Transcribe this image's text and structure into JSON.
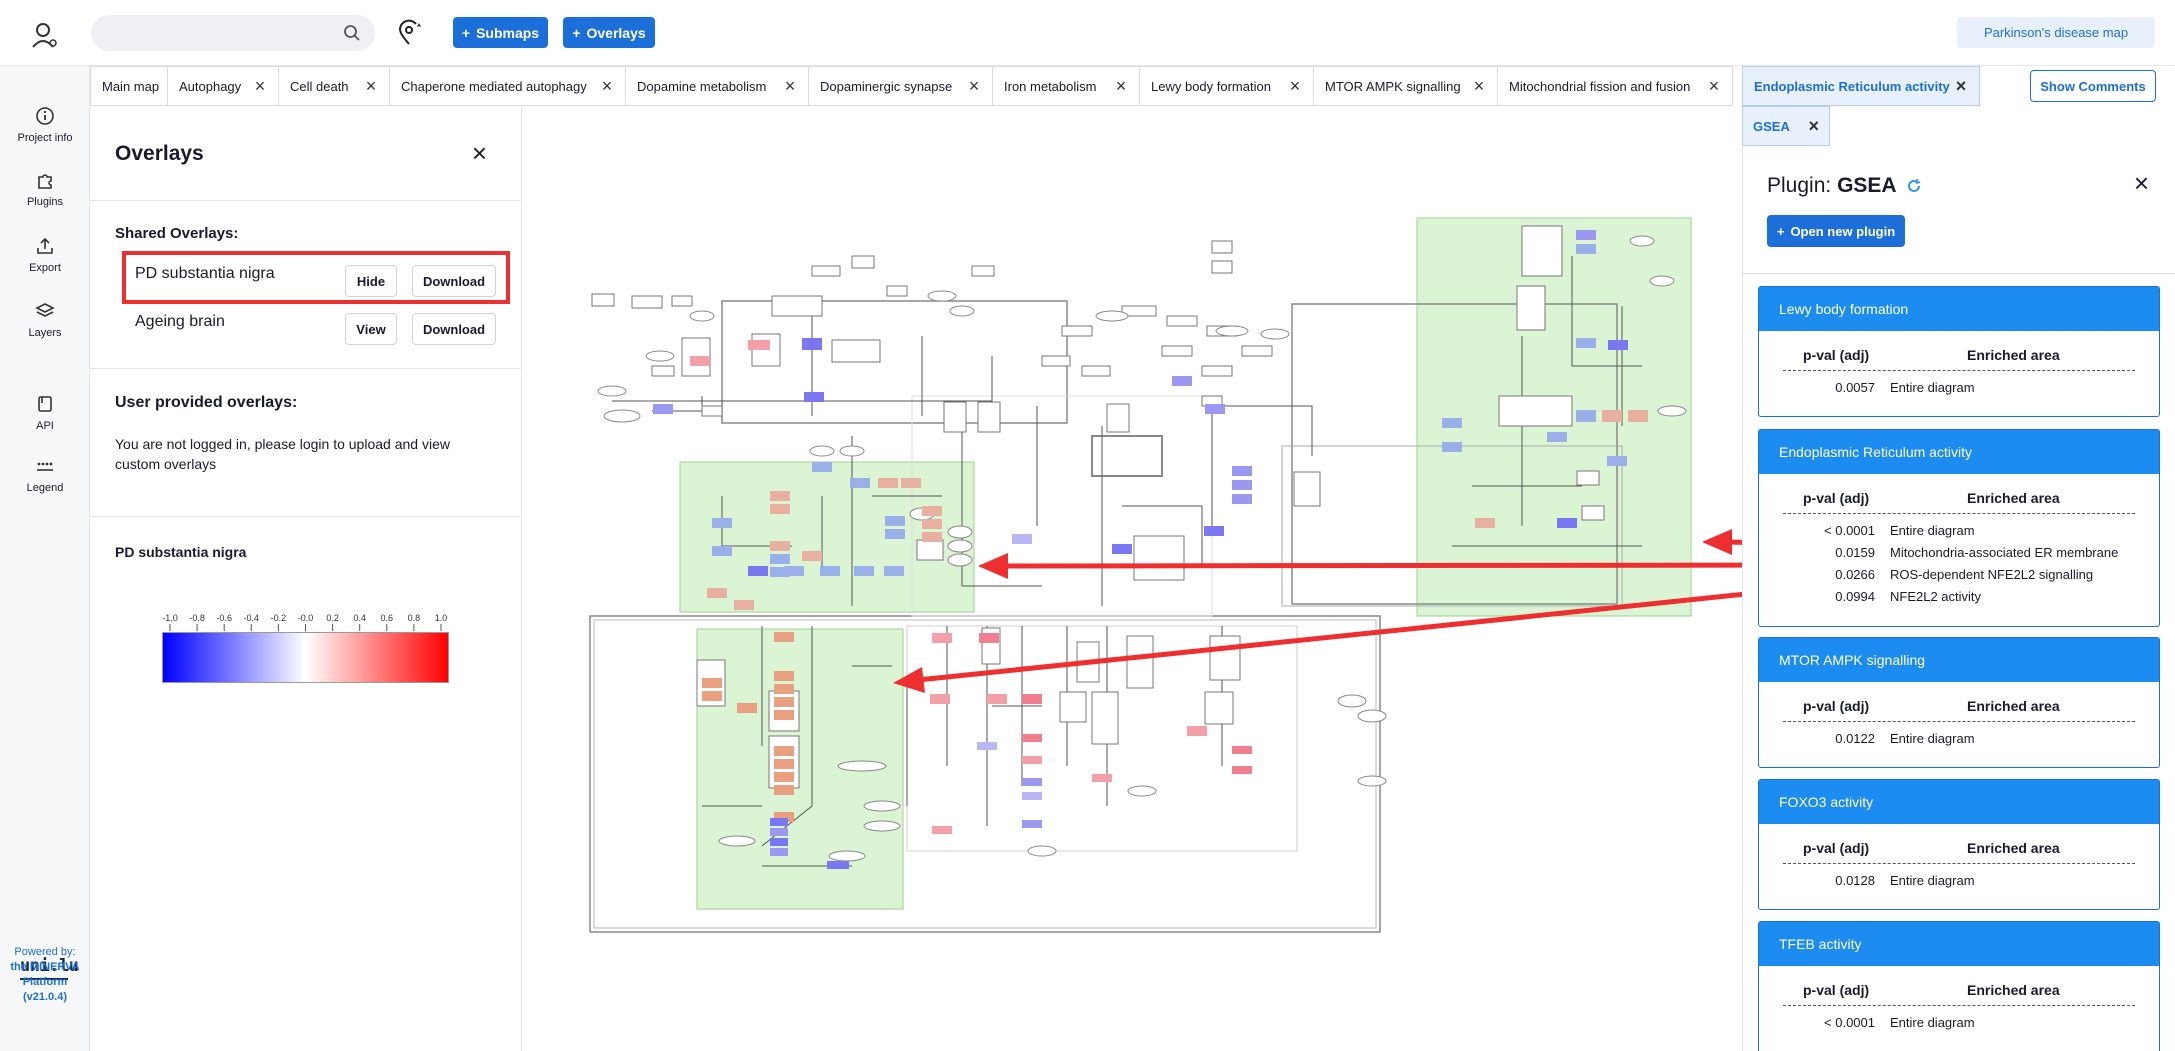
{
  "header": {
    "submaps_label": "Submaps",
    "overlays_label": "Overlays",
    "project_name": "Parkinson's disease map",
    "search_placeholder": ""
  },
  "tabs": [
    {
      "label": "Main map"
    },
    {
      "label": "Autophagy"
    },
    {
      "label": "Cell death"
    },
    {
      "label": "Chaperone mediated autophagy"
    },
    {
      "label": "Dopamine metabolism"
    },
    {
      "label": "Dopaminergic synapse"
    },
    {
      "label": "Iron metabolism"
    },
    {
      "label": "Lewy body formation"
    },
    {
      "label": "MTOR AMPK signalling"
    },
    {
      "label": "Mitochondrial fission and fusion"
    },
    {
      "label": "Endoplasmic Reticulum activity"
    },
    {
      "label": "GSEA"
    }
  ],
  "show_comments": "Show Comments",
  "nav": {
    "project_info": "Project info",
    "plugins": "Plugins",
    "export": "Export",
    "layers": "Layers",
    "api": "API",
    "legend": "Legend",
    "logo_text": "uni.lu",
    "powered_line1": "Powered by:",
    "powered_line2": "the MINERVA",
    "powered_line3": "Platform",
    "powered_line4": "(v21.0.4)"
  },
  "overlays_panel": {
    "title": "Overlays",
    "shared_title": "Shared Overlays:",
    "items": [
      {
        "name": "PD substantia nigra",
        "action": "Hide",
        "download": "Download"
      },
      {
        "name": "Ageing brain",
        "action": "View",
        "download": "Download"
      }
    ],
    "user_title": "User provided overlays:",
    "user_text": "You are not logged in, please login to upload and view custom overlays",
    "legend_title": "PD substantia nigra",
    "legend_ticks": [
      "-1.0",
      "-0.8",
      "-0.6",
      "-0.4",
      "-0.2",
      "-0.0",
      "0.2",
      "0.4",
      "0.6",
      "0.8",
      "1.0"
    ],
    "legend_min_color": "#0000ff",
    "legend_mid_color": "#ffffff",
    "legend_max_color": "#ff0000"
  },
  "plugin": {
    "title_prefix": "Plugin:",
    "title_name": "GSEA",
    "open_new": "Open new plugin",
    "col_pval": "p-val (adj)",
    "col_area": "Enriched area",
    "cards": [
      {
        "name": "Lewy body formation",
        "rows": [
          [
            "0.0057",
            "Entire diagram"
          ]
        ]
      },
      {
        "name": "Endoplasmic Reticulum activity",
        "rows": [
          [
            "< 0.0001",
            "Entire diagram"
          ],
          [
            "0.0159",
            "Mitochondria-associated ER membrane"
          ],
          [
            "0.0266",
            "ROS-dependent NFE2L2 signalling"
          ],
          [
            "0.0994",
            "NFE2L2 activity"
          ]
        ]
      },
      {
        "name": "MTOR AMPK signalling",
        "rows": [
          [
            "0.0122",
            "Entire diagram"
          ]
        ]
      },
      {
        "name": "FOXO3 activity",
        "rows": [
          [
            "0.0128",
            "Entire diagram"
          ]
        ]
      },
      {
        "name": "TFEB activity",
        "rows": [
          [
            "< 0.0001",
            "Entire diagram"
          ]
        ]
      }
    ]
  },
  "colors": {
    "accent": "#1c6fd9",
    "card_header": "#1c8cf0",
    "highlight_red": "#ef2f2f",
    "area_green": "#d9f5d3"
  }
}
